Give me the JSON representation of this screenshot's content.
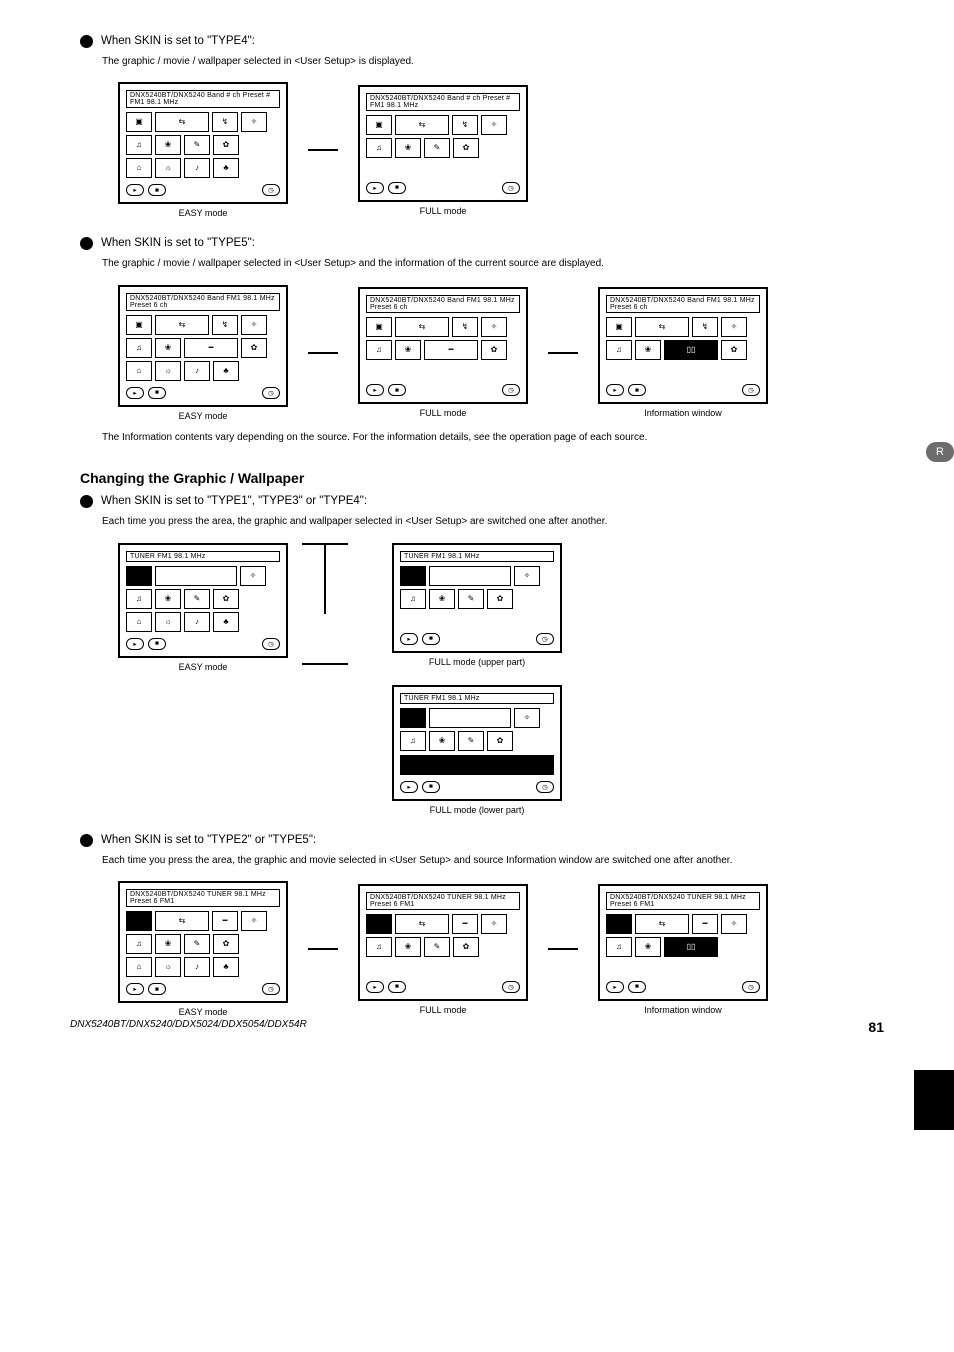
{
  "sideTab": "R",
  "footer": {
    "book": "DNX5240BT/DNX5240/DDX5024/DDX5054/DDX54R",
    "page": "81"
  },
  "sec1": {
    "bullet": "When SKIN is set to \"TYPE4\":",
    "body": "The graphic / movie / wallpaper selected in <User Setup> is displayed.",
    "cap1": "EASY mode",
    "cap2": "FULL mode",
    "tb_easy": "DNX5240BT/DNX5240 Band   #  ch  Preset  #  FM1   98.1   MHz",
    "tb_full": "DNX5240BT/DNX5240 Band   #  ch  Preset  #  FM1   98.1   MHz"
  },
  "sec2": {
    "bullet": "When SKIN is set to \"TYPE5\":",
    "body": "The graphic / movie / wallpaper selected in <User Setup> and the information of the current source are displayed.",
    "cap1": "EASY mode",
    "cap2": "FULL mode",
    "cap3": "Information window",
    "note": "The Information contents vary depending on the source. For the information details, see the operation page of each source.",
    "tb_easy": "DNX5240BT/DNX5240   Band   FM1   98.1 MHz   Preset  6     ch        ",
    "tb_full": "DNX5240BT/DNX5240   Band   FM1   98.1 MHz   Preset  6     ch        ",
    "tb_info": "DNX5240BT/DNX5240   Band   FM1   98.1 MHz   Preset  6     ch        "
  },
  "heading": "Changing the Graphic / Wallpaper",
  "sec3": {
    "bullet": "When SKIN is set to \"TYPE1\", \"TYPE3\" or \"TYPE4\":",
    "body": "Each time you press the area, the graphic and wallpaper selected in <User Setup> are switched one after another.",
    "cap1": "EASY mode",
    "cap2a": "FULL mode (upper part)",
    "cap2b": "FULL mode (lower part)",
    "tb_easy": "TUNER     FM1   98.1   MHz",
    "tb_full": "TUNER     FM1   98.1   MHz"
  },
  "sec4": {
    "bullet": "When SKIN is set to \"TYPE2\" or \"TYPE5\":",
    "body": "Each time you press the area, the graphic and movie selected in <User Setup> and source Information window are switched one after another.",
    "cap1": "EASY mode",
    "cap2": "FULL mode",
    "cap3": "Information window",
    "tb_easy": "DNX5240BT/DNX5240   TUNER   98.1   MHz   Preset  6     FM1",
    "tb_full": "DNX5240BT/DNX5240   TUNER   98.1   MHz   Preset  6     FM1",
    "tb_info": "DNX5240BT/DNX5240   TUNER   98.1   MHz   Preset  6     FM1"
  }
}
